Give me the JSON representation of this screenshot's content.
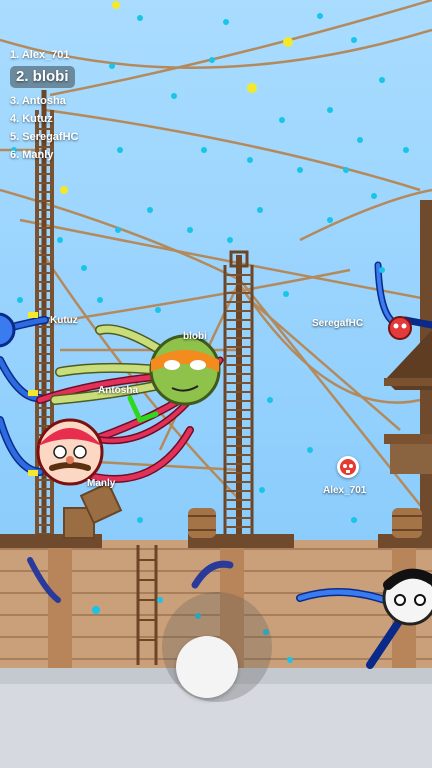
{
  "leaderboard": [
    {
      "rank_label": "1. Alex_701",
      "is_player": false
    },
    {
      "rank_label": "2. blobi",
      "is_player": true
    },
    {
      "rank_label": "3. Antosha",
      "is_player": false
    },
    {
      "rank_label": "4. Kutuz",
      "is_player": false
    },
    {
      "rank_label": "5. SeregafHC",
      "is_player": false
    },
    {
      "rank_label": "6. Manly",
      "is_player": false
    }
  ],
  "players": {
    "blobi": "blobi",
    "antosha": "Antosha",
    "kutuz": "Kutuz",
    "manly": "Manly",
    "seregafhc": "SeregafHC",
    "alex": "Alex_701"
  },
  "colors": {
    "sky": "#8fd0ff",
    "deck_wood": "#c99b6a",
    "confetti": "#18c4e8",
    "leader_highlight": "#2e2e2e"
  },
  "icons": {
    "kill_marker": "skull-icon",
    "joystick": "virtual-joystick"
  }
}
